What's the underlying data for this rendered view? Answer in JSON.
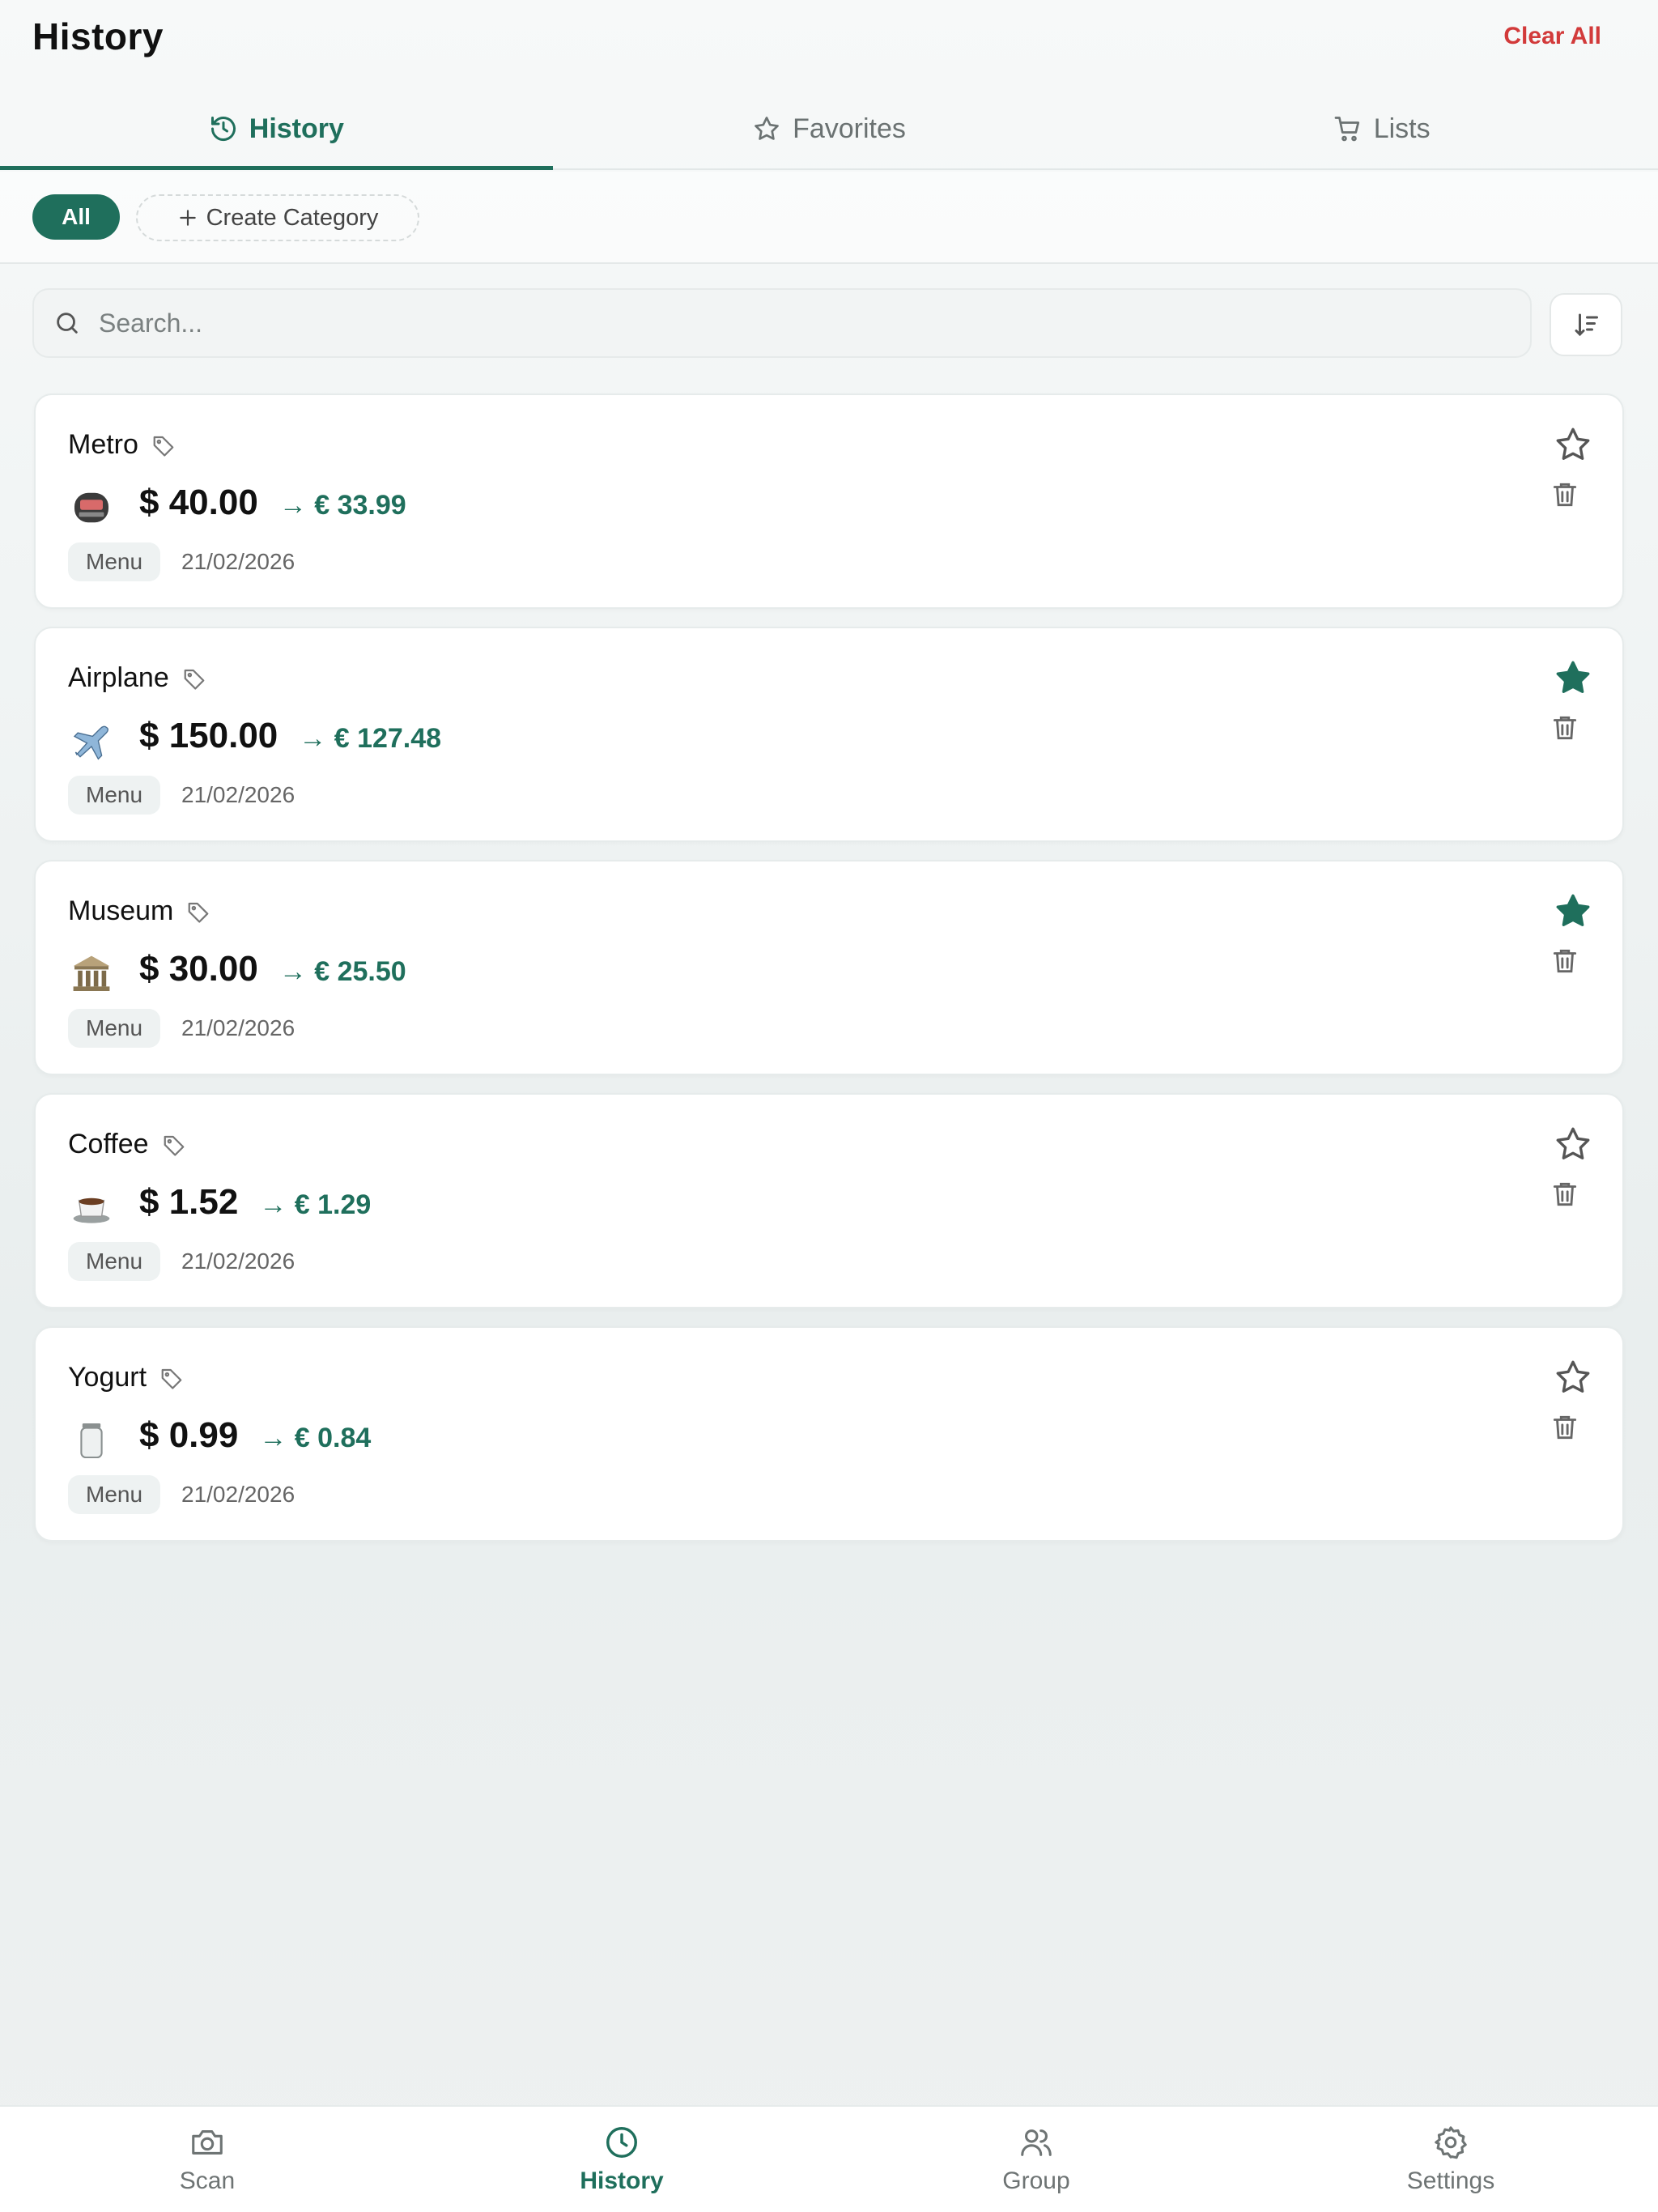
{
  "header": {
    "title": "History",
    "clear_all": "Clear All"
  },
  "tabs": [
    {
      "label": "History",
      "icon": "history-icon",
      "active": true
    },
    {
      "label": "Favorites",
      "icon": "star-icon",
      "active": false
    },
    {
      "label": "Lists",
      "icon": "cart-icon",
      "active": false
    }
  ],
  "filters": {
    "all_label": "All",
    "create_label": "Create Category",
    "create_icon": "plus-icon"
  },
  "search": {
    "placeholder": "Search..."
  },
  "items": [
    {
      "name": "Metro",
      "icon": "metro-train-icon",
      "price": "$ 40.00",
      "converted": "→ € 33.99",
      "tag": "Menu",
      "date": "21/02/2026",
      "favorite": false
    },
    {
      "name": "Airplane",
      "icon": "airplane-icon",
      "price": "$ 150.00",
      "converted": "→ € 127.48",
      "tag": "Menu",
      "date": "21/02/2026",
      "favorite": true
    },
    {
      "name": "Museum",
      "icon": "museum-icon",
      "price": "$ 30.00",
      "converted": "→ € 25.50",
      "tag": "Menu",
      "date": "21/02/2026",
      "favorite": true
    },
    {
      "name": "Coffee",
      "icon": "coffee-icon",
      "price": "$ 1.52",
      "converted": "→ € 1.29",
      "tag": "Menu",
      "date": "21/02/2026",
      "favorite": false
    },
    {
      "name": "Yogurt",
      "icon": "yogurt-jar-icon",
      "price": "$ 0.99",
      "converted": "→ € 0.84",
      "tag": "Menu",
      "date": "21/02/2026",
      "favorite": false
    }
  ],
  "bottom_nav": [
    {
      "label": "Scan",
      "icon": "camera-icon",
      "active": false
    },
    {
      "label": "History",
      "icon": "clock-icon",
      "active": true
    },
    {
      "label": "Group",
      "icon": "users-icon",
      "active": false
    },
    {
      "label": "Settings",
      "icon": "gear-icon",
      "active": false
    }
  ],
  "colors": {
    "accent": "#1f6f5c",
    "danger": "#d23a3a",
    "muted": "#6e7474"
  }
}
